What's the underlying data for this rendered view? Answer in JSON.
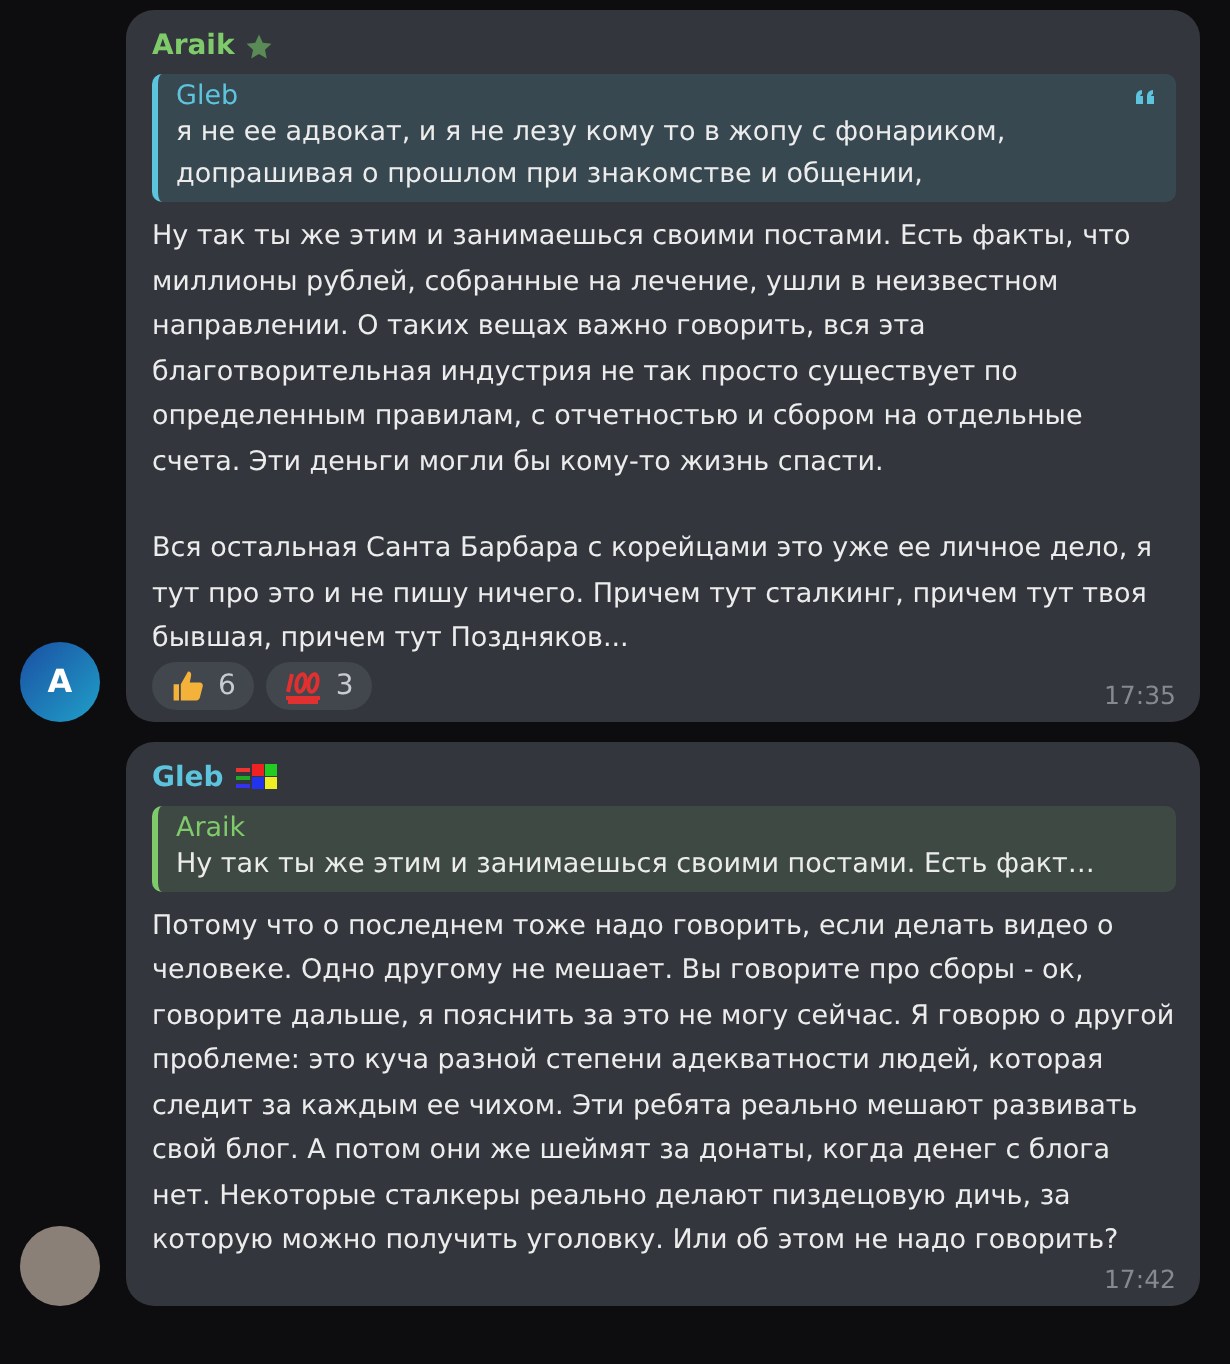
{
  "messages": [
    {
      "author": "Araik",
      "color": "#7fca6b",
      "badge": {
        "kind": "star"
      },
      "avatar": {
        "kind": "letter",
        "letter": "A"
      },
      "reply": {
        "author": "Gleb",
        "color": "#5cc4dc",
        "text": "я не ее адвокат, и я не лезу кому то в жопу с фонариком, допрашивая о прошлом при знакомстве и общении,",
        "quote_icon": true
      },
      "paragraphs": [
        "Ну так ты же этим и занимаешься своими постами. Есть факты, что миллионы рублей, собранные на лечение, ушли в неизвестном направлении. О таких вещах важно говорить, вся эта благотворительная индустрия не так просто существует по определенным правилам, с отчетностью и сбором на отдельные счета. Эти деньги могли бы кому-то жизнь спасти.",
        "Вся остальная Санта Барбара с корейцами это уже ее личное дело, я тут про это и не пишу ничего. Причем тут сталкинг, причем тут твоя бывшая, причем тут Поздняков..."
      ],
      "reactions": [
        {
          "kind": "thumbs_up",
          "count": "6"
        },
        {
          "kind": "hundred",
          "count": "3"
        }
      ],
      "time": "17:35"
    },
    {
      "author": "Gleb",
      "color": "#5cc4dc",
      "badge": {
        "kind": "windows_flag"
      },
      "avatar": {
        "kind": "photo"
      },
      "reply": {
        "author": "Araik",
        "color": "#7fca6b",
        "text": "Ну так ты же этим и занимаешься своими постами. Есть факт…",
        "quote_icon": false
      },
      "paragraphs": [
        "Потому что о последнем тоже надо говорить, если делать видео о человеке. Одно другому не мешает. Вы говорите про сборы - ок, говорите дальше, я пояснить за это не могу сейчас. Я говорю о другой проблеме: это куча разной степени адекватности людей, которая следит за каждым ее чихом. Эти ребята реально мешают развивать свой блог. А потом они же шеймят за донаты, когда денег с блога нет. Некоторые сталкеры реально делают пиздецовую дичь, за которую можно получить уголовку. Или об этом не надо говорить?"
      ],
      "time": "17:42"
    }
  ]
}
